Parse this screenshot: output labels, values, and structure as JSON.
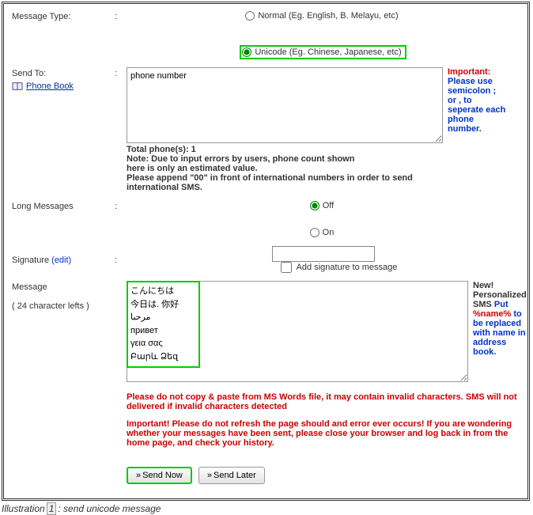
{
  "labels": {
    "messageType": "Message Type:",
    "sendTo": "Send To:",
    "longMessages": "Long Messages",
    "signature": "Signature",
    "edit": "(edit)",
    "message": "Message",
    "charLeft": "( 24 character lefts )",
    "phoneBook": "Phone Book"
  },
  "msgType": {
    "normal": "Normal (Eg. English, B. Melayu, etc)",
    "unicode": "Unicode (Eg. Chinese, Japanese, etc)"
  },
  "sendToArea": {
    "value": "phone number"
  },
  "sideImportant": {
    "title": "Important:",
    "body": "Please use semicolon ; or , to seperate each phone number."
  },
  "notes": {
    "totalPhones": "Total phone(s): 1",
    "countNote1": "Note: Due to input errors by users, phone count shown",
    "countNote2": "here is only an estimated value.",
    "intlNote": "Please append \"00\" in front of international numbers in order to send international SMS."
  },
  "longMsg": {
    "off": "Off",
    "on": "On"
  },
  "sigCheckbox": "Add signature to message",
  "messageBody": "こんにちは\n今日は. 你好\nمرحبا\nпривет\nγεια σας\nԲարև Ձեզ",
  "msgSide": {
    "new": "New!",
    "personalized": "Personalized SMS",
    "put": "Put",
    "name": "%name%",
    "rest": "to be replaced with name in address book."
  },
  "warnings": {
    "copyPaste": "Please do not copy & paste from MS Words file, it may contain invalid characters. SMS will not delivered if invalid characters detected",
    "refresh": "Important! Please do not refresh the page should and error ever occurs! If you are wondering whether your messages have been sent, please close your browser and log back in from the home page, and check your history."
  },
  "buttons": {
    "sendNow": "Send Now",
    "sendLater": "Send Later",
    "chevron": "»"
  },
  "illustration": {
    "prefix": "Illustration",
    "num": "1",
    "suffix": ": send unicode message"
  }
}
